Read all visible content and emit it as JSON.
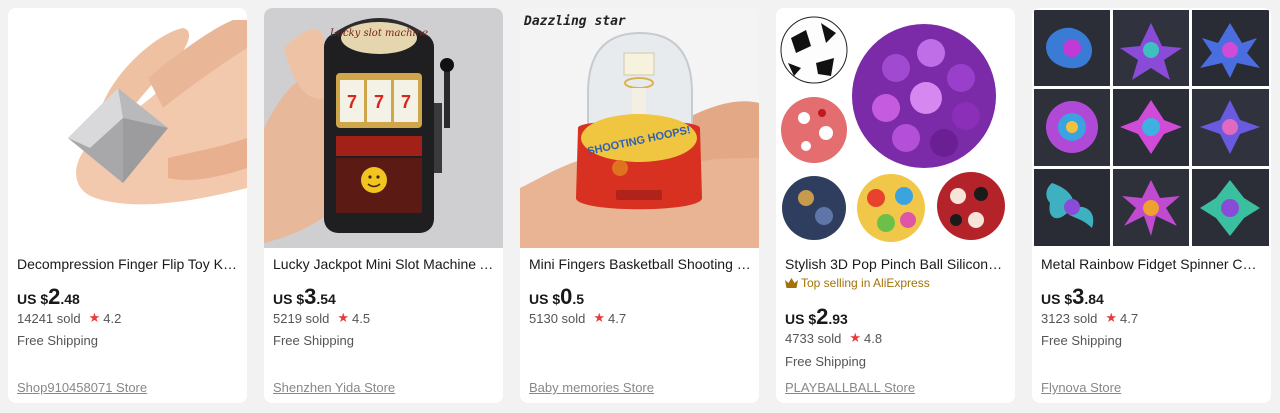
{
  "colors": {
    "star": "#e83b3b",
    "top_selling": "#a3720a",
    "store_link": "#888888"
  },
  "products": [
    {
      "title": "Decompression Finger Flip Toy Kin…",
      "currency": "US $",
      "price_int": "2",
      "price_dec": ".48",
      "sold": "14241 sold",
      "rating": "4.2",
      "shipping": "Free Shipping",
      "store": "Shop910458071 Store"
    },
    {
      "title": "Lucky Jackpot Mini Slot Machine A…",
      "currency": "US $",
      "price_int": "3",
      "price_dec": ".54",
      "sold": "5219 sold",
      "rating": "4.5",
      "shipping": "Free Shipping",
      "store": "Shenzhen Yida Store",
      "image_text": "Lucky slot machine"
    },
    {
      "title": "Mini Fingers Basketball Shooting G…",
      "currency": "US $",
      "price_int": "0",
      "price_dec": ".5",
      "sold": "5130 sold",
      "rating": "4.7",
      "store": "Baby memories Store",
      "image_text": "Dazzling star",
      "image_text2": "SHOOTING HOOPS!"
    },
    {
      "title": "Stylish 3D Pop Pinch Ball Silicone P…",
      "badge": "Top selling in AliExpress",
      "currency": "US $",
      "price_int": "2",
      "price_dec": ".93",
      "sold": "4733 sold",
      "rating": "4.8",
      "shipping": "Free Shipping",
      "store": "PLAYBALLBALL Store"
    },
    {
      "title": "Metal Rainbow Fidget Spinner Col…",
      "currency": "US $",
      "price_int": "3",
      "price_dec": ".84",
      "sold": "3123 sold",
      "rating": "4.7",
      "shipping": "Free Shipping",
      "store": "Flynova Store"
    }
  ]
}
